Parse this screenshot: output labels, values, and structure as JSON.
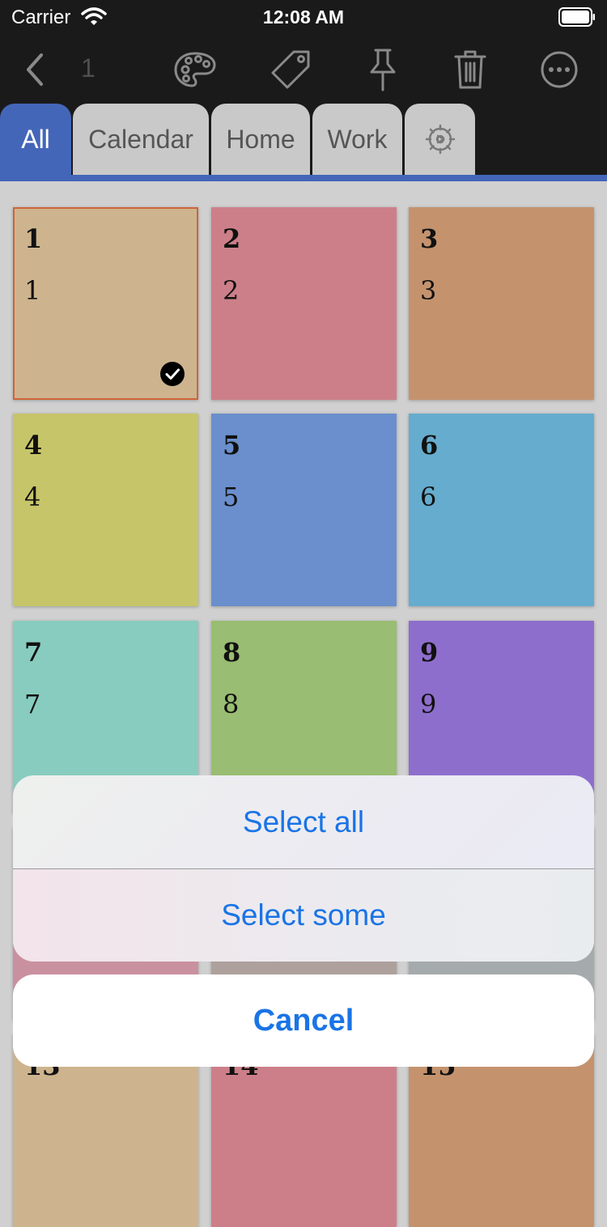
{
  "status_bar": {
    "carrier": "Carrier",
    "time": "12:08 AM"
  },
  "toolbar": {
    "selected_count": "1",
    "icons": [
      "back-chevron-icon",
      "palette-icon",
      "tag-icon",
      "pin-icon",
      "trash-icon",
      "more-icon"
    ]
  },
  "tabs": [
    {
      "label": "All",
      "active": true
    },
    {
      "label": "Calendar",
      "active": false
    },
    {
      "label": "Home",
      "active": false
    },
    {
      "label": "Work",
      "active": false
    },
    {
      "label": "",
      "icon": "settings-icon",
      "active": false
    }
  ],
  "colors": {
    "accent": "#4466b9",
    "action_blue": "#1a74e6",
    "selection_border": "#d0643a"
  },
  "notes": [
    {
      "title": "1",
      "body": "1",
      "color": "#cdb48e",
      "selected": true
    },
    {
      "title": "2",
      "body": "2",
      "color": "#cc7f88",
      "selected": false
    },
    {
      "title": "3",
      "body": "3",
      "color": "#c4936e",
      "selected": false
    },
    {
      "title": "4",
      "body": "4",
      "color": "#c7c56a",
      "selected": false
    },
    {
      "title": "5",
      "body": "5",
      "color": "#6a8fcc",
      "selected": false
    },
    {
      "title": "6",
      "body": "6",
      "color": "#66acce",
      "selected": false
    },
    {
      "title": "7",
      "body": "7",
      "color": "#88ccbf",
      "selected": false
    },
    {
      "title": "8",
      "body": "8",
      "color": "#99bd72",
      "selected": false
    },
    {
      "title": "9",
      "body": "9",
      "color": "#8e6ecc",
      "selected": false
    },
    {
      "title": "",
      "body": "",
      "color": "#c9919f",
      "selected": false
    },
    {
      "title": "",
      "body": "",
      "color": "#aea09c",
      "selected": false
    },
    {
      "title": "",
      "body": "",
      "color": "#a5aaac",
      "selected": false
    },
    {
      "title": "13",
      "body": "",
      "color": "#cdb48e",
      "selected": false
    },
    {
      "title": "14",
      "body": "",
      "color": "#cc7f88",
      "selected": false
    },
    {
      "title": "15",
      "body": "",
      "color": "#c4936e",
      "selected": false
    }
  ],
  "action_sheet": {
    "select_all_label": "Select all",
    "select_some_label": "Select some",
    "cancel_label": "Cancel"
  }
}
